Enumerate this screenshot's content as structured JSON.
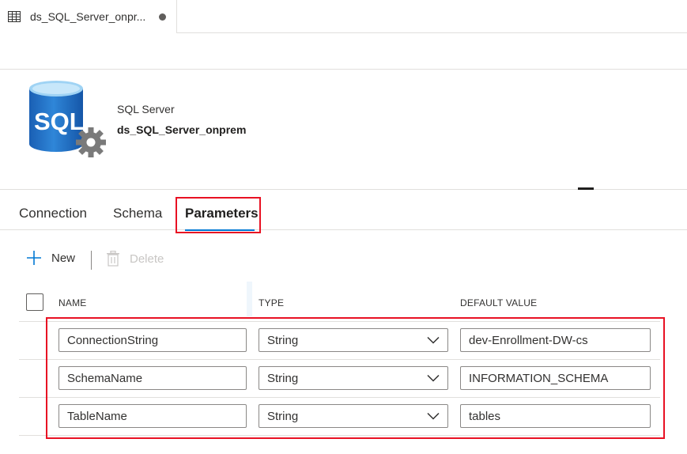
{
  "tab": {
    "title": "ds_SQL_Server_onpr...",
    "icon": "table-icon",
    "unsaved_indicator": "dot"
  },
  "dataset": {
    "logo_icon": "sql-server-database-icon",
    "logo_text": "SQL",
    "type_label": "SQL Server",
    "name": "ds_SQL_Server_onprem"
  },
  "tabs": [
    {
      "label": "Connection",
      "selected": false
    },
    {
      "label": "Schema",
      "selected": false
    },
    {
      "label": "Parameters",
      "selected": true
    }
  ],
  "toolbar": {
    "new_label": "New",
    "new_icon": "plus-icon",
    "delete_label": "Delete",
    "delete_icon": "trash-icon",
    "delete_enabled": false
  },
  "grid": {
    "columns": [
      "NAME",
      "TYPE",
      "DEFAULT VALUE"
    ],
    "rows": [
      {
        "name": "ConnectionString",
        "type": "String",
        "default": "dev-Enrollment-DW-cs"
      },
      {
        "name": "SchemaName",
        "type": "String",
        "default": "INFORMATION_SCHEMA"
      },
      {
        "name": "TableName",
        "type": "String",
        "default": "tables"
      }
    ]
  },
  "colors": {
    "accent": "#0078d4",
    "highlight": "#e81123",
    "logo_blue": "#1f6ec6",
    "gear_gray": "#7a7a7a"
  }
}
